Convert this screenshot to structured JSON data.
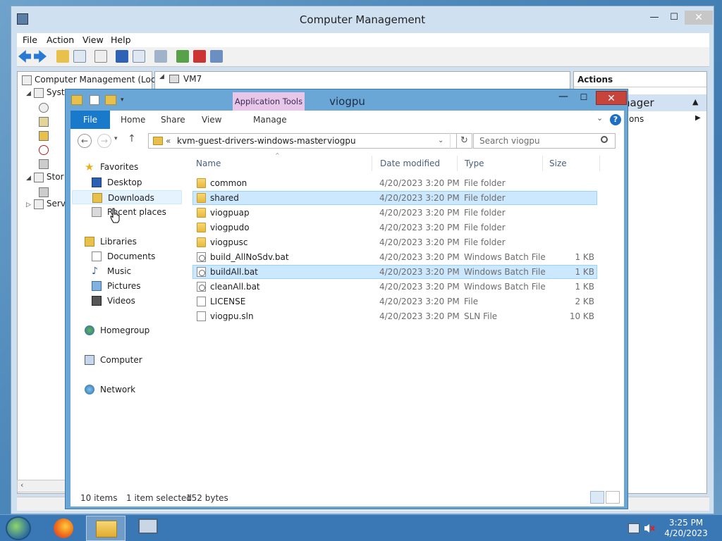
{
  "computer_management": {
    "title": "Computer Management",
    "menu": [
      "File",
      "Action",
      "View",
      "Help"
    ],
    "tree": {
      "root": "Computer Management (Local",
      "items": [
        "Syst",
        "Stor",
        "Serv"
      ]
    },
    "center_header": "VM7",
    "actions": {
      "header": "Actions",
      "section": "nager",
      "item": "tions"
    }
  },
  "explorer": {
    "title": "viogpu",
    "app_tools_label": "Application Tools",
    "ribbon_tabs": {
      "file": "File",
      "home": "Home",
      "share": "Share",
      "view": "View",
      "manage": "Manage"
    },
    "address": {
      "prefix": "«",
      "parent": "kvm-guest-drivers-windows-master",
      "separator": "›",
      "current": "viogpu"
    },
    "search_placeholder": "Search viogpu",
    "nav_pane": {
      "favorites": "Favorites",
      "desktop": "Desktop",
      "downloads": "Downloads",
      "recent_places": "Recent places",
      "libraries": "Libraries",
      "documents": "Documents",
      "music": "Music",
      "pictures": "Pictures",
      "videos": "Videos",
      "homegroup": "Homegroup",
      "computer": "Computer",
      "network": "Network"
    },
    "columns": {
      "name": "Name",
      "date_modified": "Date modified",
      "type": "Type",
      "size": "Size"
    },
    "files": [
      {
        "name": "common",
        "date": "4/20/2023 3:20 PM",
        "type": "File folder",
        "size": ""
      },
      {
        "name": "shared",
        "date": "4/20/2023 3:20 PM",
        "type": "File folder",
        "size": ""
      },
      {
        "name": "viogpuap",
        "date": "4/20/2023 3:20 PM",
        "type": "File folder",
        "size": ""
      },
      {
        "name": "viogpudo",
        "date": "4/20/2023 3:20 PM",
        "type": "File folder",
        "size": ""
      },
      {
        "name": "viogpusc",
        "date": "4/20/2023 3:20 PM",
        "type": "File folder",
        "size": ""
      },
      {
        "name": "build_AllNoSdv.bat",
        "date": "4/20/2023 3:20 PM",
        "type": "Windows Batch File",
        "size": "1 KB"
      },
      {
        "name": "buildAll.bat",
        "date": "4/20/2023 3:20 PM",
        "type": "Windows Batch File",
        "size": "1 KB"
      },
      {
        "name": "cleanAll.bat",
        "date": "4/20/2023 3:20 PM",
        "type": "Windows Batch File",
        "size": "1 KB"
      },
      {
        "name": "LICENSE",
        "date": "4/20/2023 3:20 PM",
        "type": "File",
        "size": "2 KB"
      },
      {
        "name": "viogpu.sln",
        "date": "4/20/2023 3:20 PM",
        "type": "SLN File",
        "size": "10 KB"
      }
    ],
    "status": {
      "item_count": "10 items",
      "selection": "1 item selected",
      "selection_size": "152 bytes"
    }
  },
  "taskbar": {
    "time": "3:25 PM",
    "date": "4/20/2023"
  },
  "colors": {
    "accent": "#1979ca",
    "selection": "#cce8ff",
    "close_button": "#c7443a",
    "app_tools": "#e7c6e8"
  }
}
